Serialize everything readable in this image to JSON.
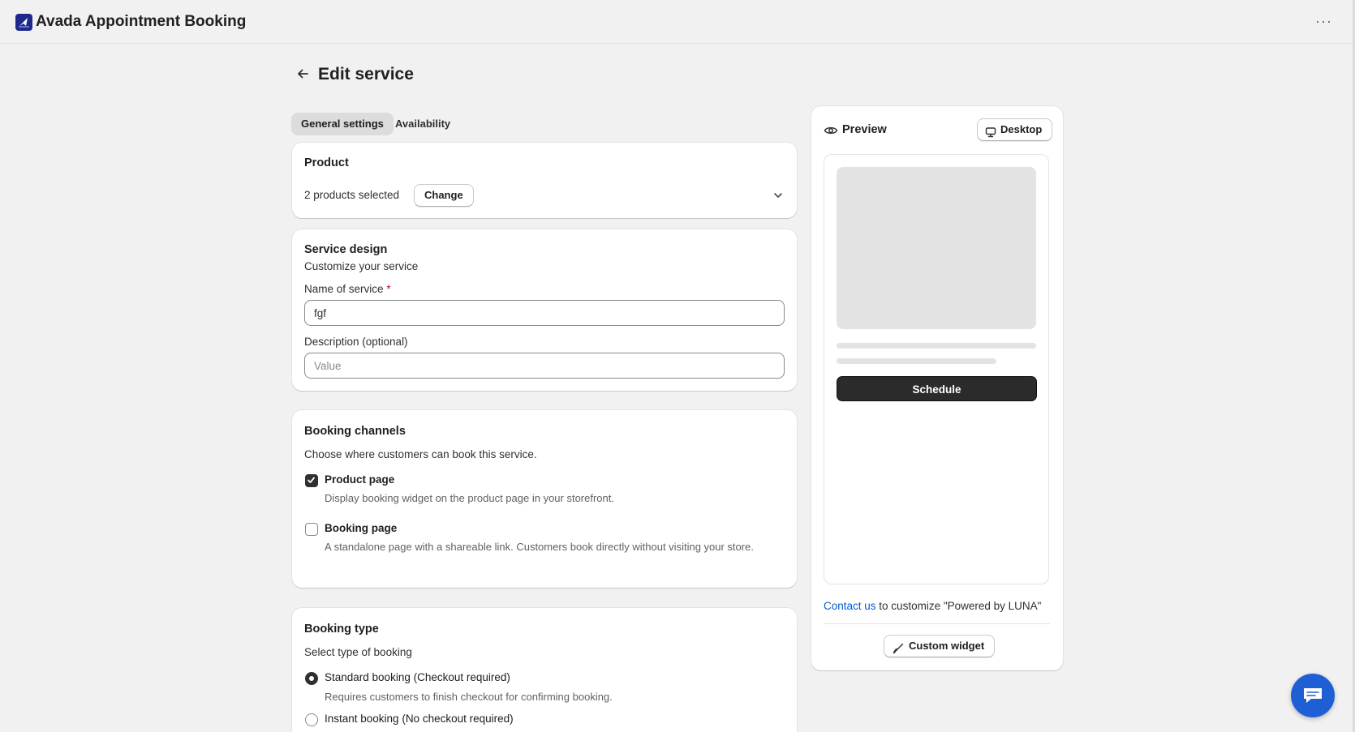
{
  "app": {
    "title": "Avada Appointment Booking",
    "menu_glyph": "···"
  },
  "page": {
    "title": "Edit service",
    "back_glyph": "←"
  },
  "tabs": [
    {
      "label": "General settings",
      "active": true
    },
    {
      "label": "Availability",
      "active": false
    }
  ],
  "product": {
    "title": "Product",
    "selected_text": "2 products selected",
    "change_label": "Change"
  },
  "service_design": {
    "title": "Service design",
    "subtitle": "Customize your service",
    "name_label": "Name of service",
    "name_required": "*",
    "name_value": "fgf",
    "description_label": "Description (optional)",
    "description_placeholder": "Value"
  },
  "booking_channels": {
    "title": "Booking channels",
    "subtitle": "Choose where customers can book this service.",
    "options": [
      {
        "label": "Product page",
        "help": "Display booking widget on the product page in your storefront.",
        "checked": true
      },
      {
        "label": "Booking page",
        "help": "A standalone page with a shareable link. Customers book directly without visiting your store.",
        "checked": false
      }
    ]
  },
  "booking_type": {
    "title": "Booking type",
    "subtitle": "Select type of booking",
    "options": [
      {
        "label": "Standard booking (Checkout required)",
        "help": "Requires customers to finish checkout for confirming booking.",
        "checked": true
      },
      {
        "label": "Instant booking (No checkout required)",
        "checked": false
      }
    ]
  },
  "preview": {
    "title": "Preview",
    "device_label": "Desktop",
    "schedule_label": "Schedule",
    "contact_link": "Contact us",
    "contact_rest": " to customize \"Powered by LUNA\"",
    "custom_widget_label": "Custom widget"
  },
  "colors": {
    "accent": "#1f5fd6",
    "link": "#005bd3",
    "background": "#f1f1f1",
    "primary_button": "#2b2b2b"
  }
}
